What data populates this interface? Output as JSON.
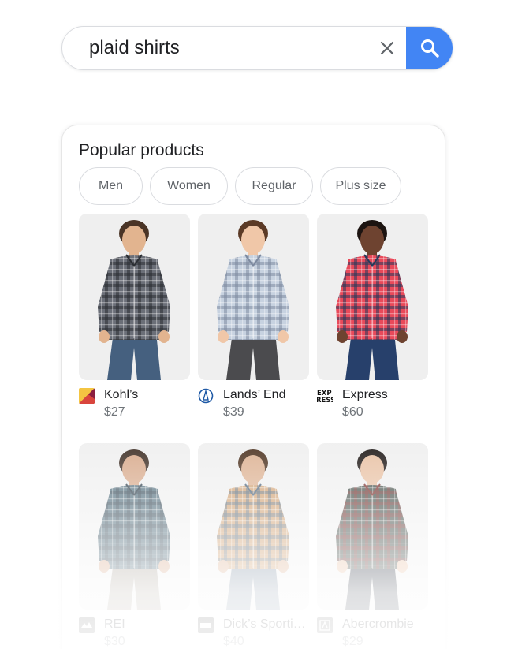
{
  "search": {
    "query": "plaid shirts",
    "clear_icon": "close-icon",
    "search_icon": "search-icon",
    "accent": "#4285f4"
  },
  "card": {
    "title": "Popular products",
    "chips": [
      "Men",
      "Women",
      "Regular",
      "Plus size"
    ]
  },
  "products": [
    {
      "store": "Kohl’s",
      "price": "$27",
      "logo": "kohls-logo",
      "shirt_color": "#6b6f78",
      "accent": "#2b2e33",
      "skin": "#e2b48f",
      "hair": "#4a3426",
      "pants": "#45607f"
    },
    {
      "store": "Lands’ End",
      "price": "$39",
      "logo": "lands-end-logo",
      "shirt_color": "#c7d2e0",
      "accent": "#7d8aa0",
      "skin": "#f0c7a8",
      "hair": "#5b3a26",
      "pants": "#4b4b4e"
    },
    {
      "store": "Express",
      "price": "$60",
      "logo": "express-logo",
      "logo_text": "EXP RESS",
      "shirt_color": "#e84a5a",
      "accent": "#263a5a",
      "skin": "#6e4330",
      "hair": "#1c1411",
      "pants": "#27406b"
    },
    {
      "store": "REI",
      "price": "$30",
      "logo": "rei-logo",
      "shirt_color": "#4e6b7a",
      "accent": "#2c3c48",
      "skin": "#d7a889",
      "hair": "#3a2a20",
      "pants": "#a79f94"
    },
    {
      "store": "Dick’s Sporting Goods",
      "price": "$40",
      "logo": "dicks-logo",
      "shirt_color": "#cf9f70",
      "accent": "#49627a",
      "skin": "#dcb090",
      "hair": "#4a2f1c",
      "pants": "#7c8da0"
    },
    {
      "store": "Abercrombie",
      "price": "$29",
      "logo": "abercrombie-logo",
      "shirt_color": "#3f4a44",
      "accent": "#7a2a26",
      "skin": "#e8c0a2",
      "hair": "#1a1412",
      "pants": "#2b3240"
    }
  ]
}
